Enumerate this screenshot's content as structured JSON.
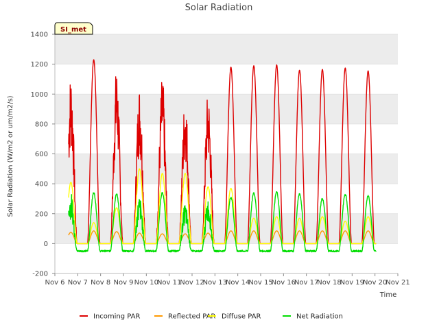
{
  "chart_data": {
    "type": "line",
    "title": "Solar Radiation",
    "xlabel": "Time",
    "ylabel": "Solar Radiation (W/m2 or um/m2/s)",
    "badge": "SI_met",
    "xlim": [
      6,
      21
    ],
    "ylim": [
      -200,
      1400
    ],
    "x_ticks": [
      "Nov 6",
      "Nov 7",
      "Nov 8",
      "Nov 9",
      "Nov 10",
      "Nov 11",
      "Nov 12",
      "Nov 13",
      "Nov 14",
      "Nov 15",
      "Nov 16",
      "Nov 17",
      "Nov 18",
      "Nov 19",
      "Nov 20",
      "Nov 21"
    ],
    "y_ticks": [
      -200,
      0,
      200,
      400,
      600,
      800,
      1000,
      1200,
      1400
    ],
    "shaded_bands": [
      [
        1200,
        1400
      ],
      [
        800,
        1000
      ],
      [
        400,
        600
      ],
      [
        0,
        200
      ]
    ],
    "grid": true,
    "legend_position": "bottom",
    "series": [
      {
        "name": "Incoming PAR",
        "color": "#dd0000",
        "days": [
          6.7,
          7.7,
          8.7,
          9.7,
          10.7,
          11.7,
          12.7,
          13.7,
          14.7,
          15.7,
          16.7,
          17.7,
          18.7,
          19.7
        ],
        "peaks": [
          1150,
          1230,
          1190,
          1070,
          1120,
          1000,
          1020,
          1180,
          1190,
          1195,
          1160,
          1165,
          1175,
          1155
        ],
        "base": 0,
        "noisy_days": [
          0,
          2,
          3,
          4,
          5,
          6
        ]
      },
      {
        "name": "Reflected PAR",
        "color": "#ff9900",
        "days": [
          6.7,
          7.7,
          8.7,
          9.7,
          10.7,
          11.7,
          12.7,
          13.7,
          14.7,
          15.7,
          16.7,
          17.7,
          18.7,
          19.7
        ],
        "peaks": [
          75,
          85,
          80,
          70,
          65,
          65,
          70,
          85,
          85,
          85,
          85,
          85,
          85,
          85
        ],
        "base": 0,
        "noisy_days": []
      },
      {
        "name": "Diffuse PAR",
        "color": "#ffff00",
        "days": [
          6.7,
          7.7,
          8.7,
          9.7,
          10.7,
          11.7,
          12.7,
          13.7,
          14.7,
          15.7,
          16.7,
          17.7,
          18.7,
          19.7
        ],
        "peaks": [
          410,
          140,
          240,
          500,
          470,
          470,
          380,
          370,
          170,
          180,
          170,
          180,
          150,
          180
        ],
        "base": 0,
        "noisy_days": []
      },
      {
        "name": "Net Radiation",
        "color": "#00dd00",
        "days": [
          6.7,
          7.7,
          8.7,
          9.7,
          10.7,
          11.7,
          12.7,
          13.7,
          14.7,
          15.7,
          16.7,
          17.7,
          18.7,
          19.7
        ],
        "peaks": [
          340,
          340,
          330,
          320,
          340,
          270,
          300,
          310,
          340,
          345,
          330,
          300,
          330,
          320
        ],
        "base": -50,
        "noisy_days": [
          0,
          3,
          5,
          6
        ]
      }
    ]
  }
}
